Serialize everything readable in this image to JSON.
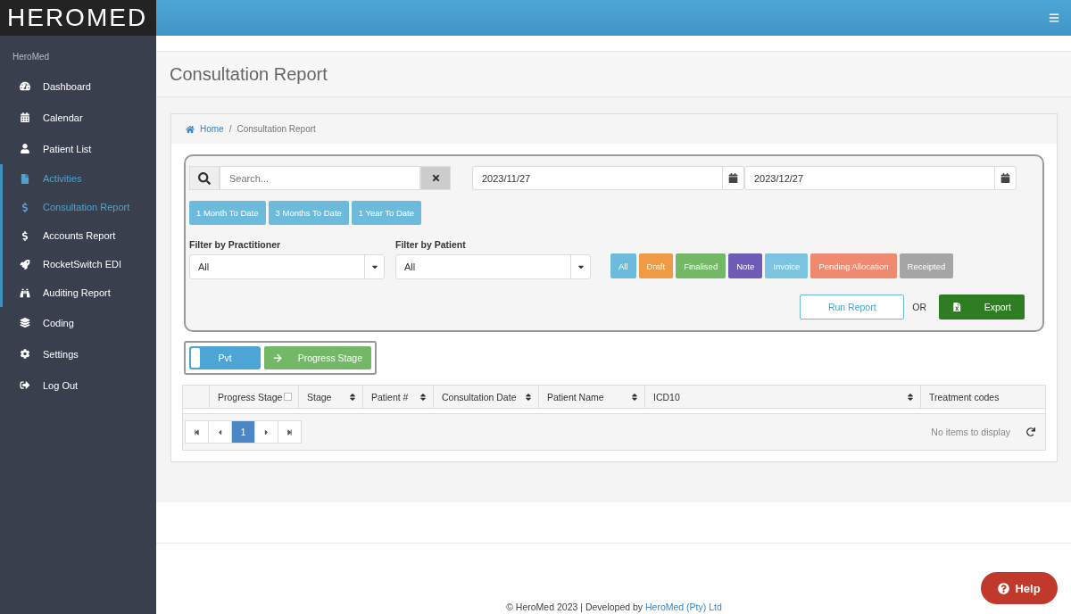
{
  "logo": "HEROMED",
  "sidebar": {
    "heading": "HeroMed",
    "items": [
      {
        "label": "Dashboard",
        "selected": false
      },
      {
        "label": "Calendar",
        "selected": false
      },
      {
        "label": "Patient List",
        "selected": false
      },
      {
        "label": "Activities",
        "selected": true,
        "expanded": true,
        "children": [
          {
            "label": "Consultation Report",
            "selected": true
          },
          {
            "label": "Accounts Report",
            "selected": false
          },
          {
            "label": "RocketSwitch EDI",
            "selected": false
          },
          {
            "label": "Auditing Report",
            "selected": false
          }
        ]
      },
      {
        "label": "Coding",
        "selected": false
      },
      {
        "label": "Settings",
        "selected": false
      },
      {
        "label": "Log Out",
        "selected": false
      }
    ]
  },
  "page_title": "Consultation Report",
  "breadcrumb": {
    "separator": "/",
    "items": [
      "Home",
      "Consultation Report"
    ]
  },
  "search": {
    "placeholder": "Search..."
  },
  "date_from": "2023/11/27",
  "date_to": "2023/12/27",
  "range_buttons": [
    "1 Month To Date",
    "3 Months To Date",
    "1 Year To Date"
  ],
  "filters": [
    {
      "label": "Filter by Practitioner",
      "value": "All"
    },
    {
      "label": "Filter by Patient",
      "value": "All"
    }
  ],
  "status_buttons": [
    {
      "label": "All",
      "color": "#6cbbdd"
    },
    {
      "label": "Draft",
      "color": "#ef9a45"
    },
    {
      "label": "Finalised",
      "color": "#72b866"
    },
    {
      "label": "Note",
      "color": "#6e5cb6"
    },
    {
      "label": "Invoice",
      "color": "#7cc3e0"
    },
    {
      "label": "Pending Allocation",
      "color": "#ef8a70"
    },
    {
      "label": "Receipted",
      "color": "#a5a5a5"
    }
  ],
  "run_report": "Run Report",
  "or": "OR",
  "export": "Export",
  "toggle": {
    "label": "Pvt",
    "on": false
  },
  "progress_button": "Progress Stage",
  "table": {
    "columns": [
      {
        "label": "Progress Stage",
        "sortable": false,
        "checkbox": true,
        "checked": false
      },
      {
        "label": "Stage",
        "sortable": true
      },
      {
        "label": "Patient #",
        "sortable": true
      },
      {
        "label": "Consultation Date",
        "sortable": true
      },
      {
        "label": "Patient Name",
        "sortable": true
      },
      {
        "label": "ICD10",
        "sortable": true
      },
      {
        "label": "Treatment codes",
        "sortable": false
      }
    ]
  },
  "pagination": {
    "pages": [
      {
        "label": "1",
        "selected": true
      }
    ],
    "status": "No items to display"
  },
  "footer": {
    "text": "© HeroMed 2023 | Developed by ",
    "link": "HeroMed (Pty) Ltd"
  },
  "help": "Help"
}
